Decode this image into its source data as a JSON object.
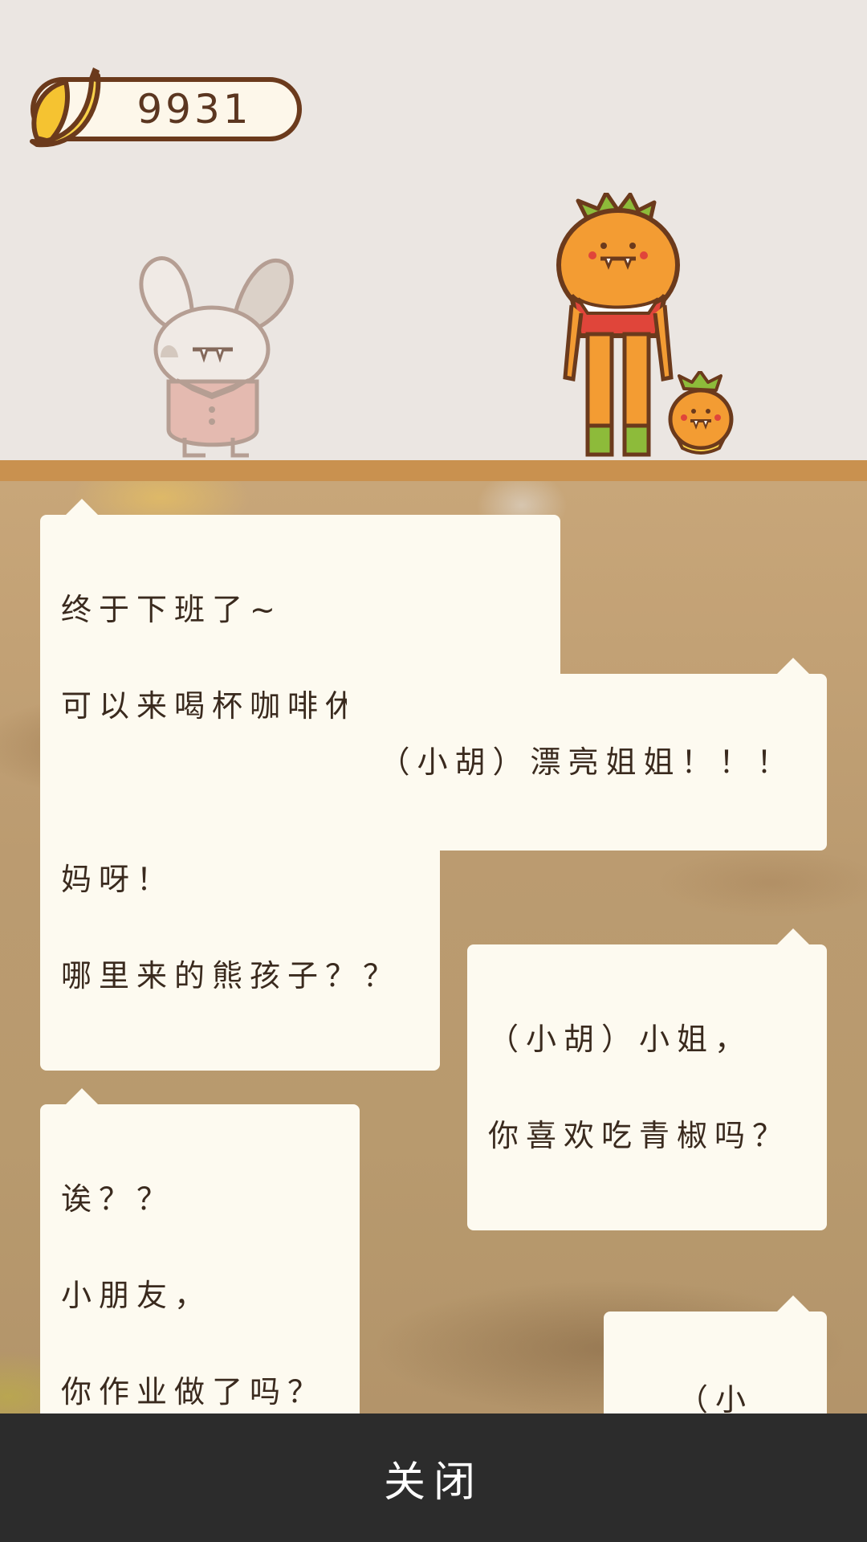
{
  "hud": {
    "banana_count": "9931",
    "banana_icon": "banana-icon"
  },
  "characters": [
    "rabbit-customer",
    "carrot-kid",
    "small-carrot-pet"
  ],
  "messages": [
    {
      "side": "left",
      "lines": [
        "终于下班了~",
        "可以来喝杯咖啡休息一下。"
      ]
    },
    {
      "side": "right",
      "lines": [
        "（小胡）漂亮姐姐！！！"
      ]
    },
    {
      "side": "left",
      "lines": [
        "妈呀！",
        "哪里来的熊孩子？？"
      ]
    },
    {
      "side": "right",
      "lines": [
        "（小胡）小姐，",
        "你喜欢吃青椒吗？"
      ]
    },
    {
      "side": "left",
      "lines": [
        "诶？？",
        "小朋友，",
        "你作业做了吗？"
      ]
    },
    {
      "side": "right",
      "lines": [
        "（小胡）..."
      ]
    }
  ],
  "footer": {
    "close_label": "关闭"
  },
  "colors": {
    "background": "#ebe6e2",
    "floor": "#c9914f",
    "bubble": "#fdfaf0",
    "text": "#3a2a1e",
    "close_bar": "#2c2c2c",
    "banana": "#f5c331",
    "outline": "#6b3a1c"
  }
}
